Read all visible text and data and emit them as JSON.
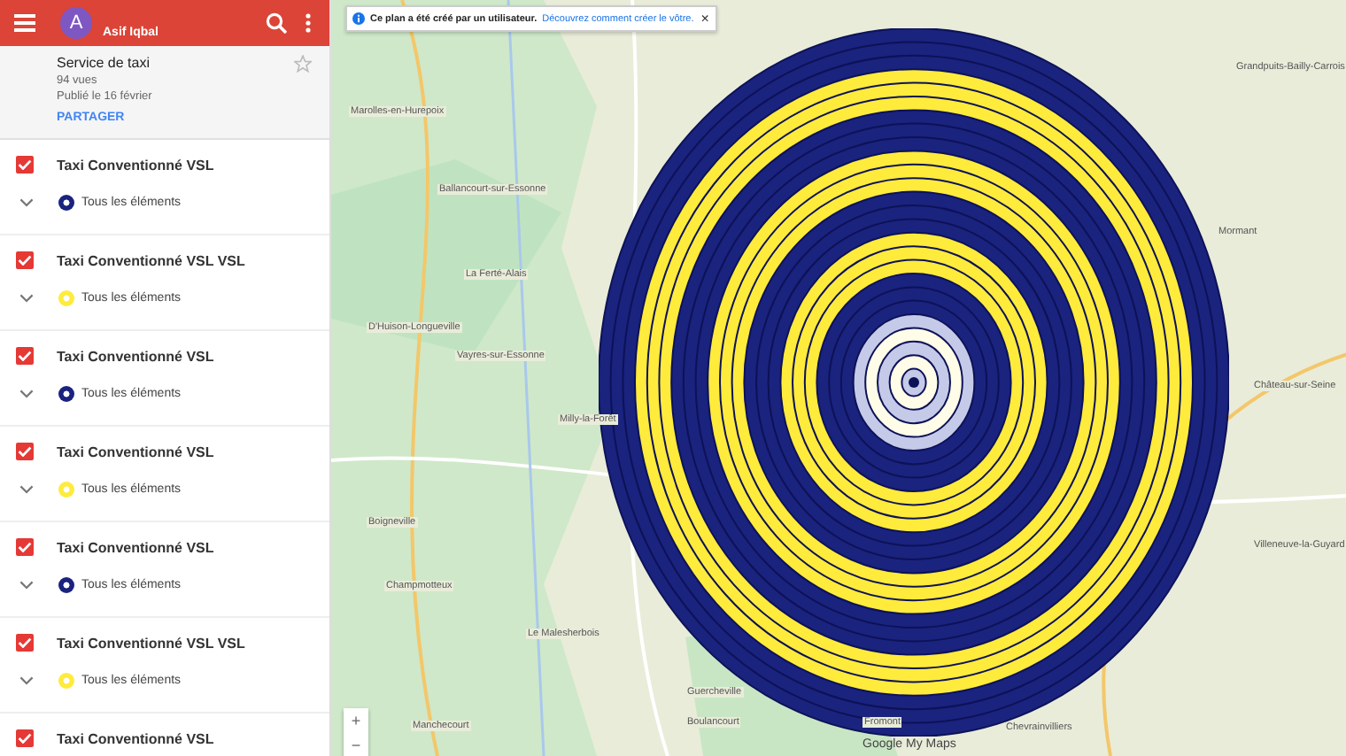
{
  "header": {
    "avatar_letter": "A",
    "user": "Asif Iqbal"
  },
  "map_info": {
    "title": "Service de taxi",
    "views": "94 vues",
    "published": "Publié le 16 février",
    "share": "PARTAGER",
    "starred": false
  },
  "layers": [
    {
      "title": "Taxi Conventionné VSL",
      "checked": true,
      "color": "#1a237e",
      "items": "Tous les éléments"
    },
    {
      "title": "Taxi Conventionné VSL VSL",
      "checked": true,
      "color": "#ffeb3b",
      "items": "Tous les éléments"
    },
    {
      "title": "Taxi Conventionné VSL",
      "checked": true,
      "color": "#1a237e",
      "items": "Tous les éléments"
    },
    {
      "title": "Taxi Conventionné VSL",
      "checked": true,
      "color": "#ffeb3b",
      "items": "Tous les éléments"
    },
    {
      "title": "Taxi Conventionné VSL",
      "checked": true,
      "color": "#1a237e",
      "items": "Tous les éléments"
    },
    {
      "title": "Taxi Conventionné VSL VSL",
      "checked": true,
      "color": "#ffeb3b",
      "items": "Tous les éléments"
    },
    {
      "title": "Taxi Conventionné VSL",
      "checked": true
    }
  ],
  "notice": {
    "text": "Ce plan a été créé par un utilisateur.",
    "link": "Découvrez comment créer le vôtre.",
    "close": "×"
  },
  "map_labels": [
    "Marolles-en-Hurepoix",
    "Ballancourt-sur-Essonne",
    "La Ferté-Alais",
    "D'Huison-Longueville",
    "Vayres-sur-Essonne",
    "Milly-la-Forêt",
    "Boigneville",
    "Champmotteux",
    "Le Malesherbois",
    "Boulancourt",
    "Fromont",
    "Chevrainvilliers",
    "Guercheville",
    "Grandpuits-Bailly-Carrois",
    "Mormant",
    "Château-sur-Seine",
    "Villeneuve-la-Guyard",
    "Manchecourt"
  ],
  "zoom": {
    "in": "+",
    "out": "−"
  },
  "attribution": "Google My Maps"
}
